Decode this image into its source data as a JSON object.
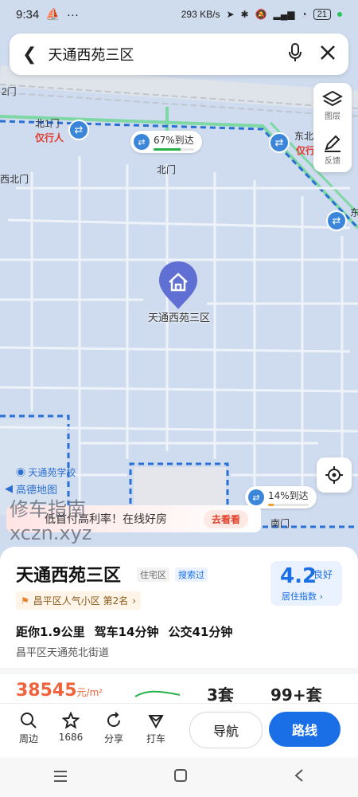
{
  "status_bar": {
    "time": "9:34",
    "more": "···",
    "net_speed": "293 KB/s",
    "battery": "21"
  },
  "search": {
    "query": "天通西苑三区"
  },
  "map_tools": {
    "layers_label": "图层",
    "feedback_label": "反馈"
  },
  "map": {
    "gate_label_2": "2门",
    "north1_gate": "北1门",
    "pedestrian": "仅行人",
    "north_gate": "北门",
    "east_north": "东北",
    "pedestrian_short": "仅行",
    "west_north_gate": "西北门",
    "east_short": "东",
    "south_gate": "南门",
    "pin_label": "天通西苑三区",
    "school": "天通苑学校",
    "amap_logo": "高德地图",
    "arrival_north": {
      "text": "67%到达",
      "value": 0.67
    },
    "arrival_south": {
      "text": "14%到达",
      "value": 0.14
    }
  },
  "watermark": {
    "line1": "修车指南",
    "line2": "xczn.xyz"
  },
  "ad": {
    "text": "低首付高利率！在线好房",
    "button": "去看看"
  },
  "poi": {
    "name": "天通西苑三区",
    "type_tag": "住宅区",
    "visited_tag": "搜索过",
    "rank": "昌平区人气小区 第2名",
    "score": "4.2",
    "score_grade": "良好",
    "score_label": "居住指数",
    "distance": "距你1.9公里",
    "drive": "驾车14分钟",
    "bus": "公交41分钟",
    "address": "昌平区天通苑北街道",
    "price": "38545",
    "price_unit": "元/m²",
    "listing_count_1": "3套",
    "listing_count_2": "99+套"
  },
  "bottom_bar": {
    "nearby": "周边",
    "favorites": "1686",
    "share": "分享",
    "taxi": "打车",
    "navigate": "导航",
    "route": "路线"
  },
  "colors": {
    "accent": "#1a6ee6",
    "station": "#3b86d9",
    "price": "#f0623a",
    "pedestrian_red": "#e23b2e"
  }
}
